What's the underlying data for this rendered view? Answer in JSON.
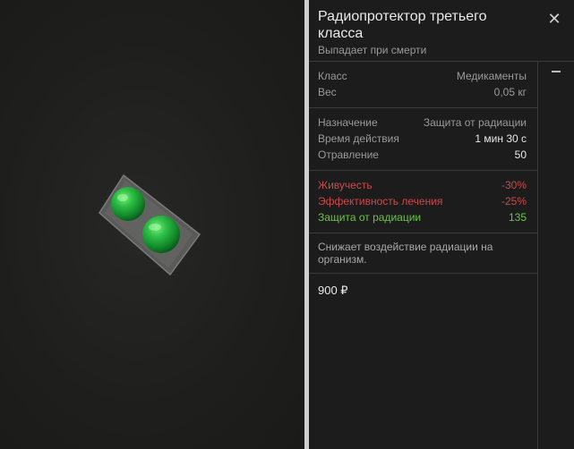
{
  "item": {
    "title": "Радиопротектор третьего класса",
    "subtitle": "Выпадает при смерти",
    "close_icon": "close-icon"
  },
  "basic": [
    {
      "label": "Класс",
      "value": "Медикаменты"
    },
    {
      "label": "Вес",
      "value": "0,05 кг"
    }
  ],
  "usage": [
    {
      "label": "Назначение",
      "value": "Защита от радиации"
    },
    {
      "label": "Время действия",
      "value": "1 мин 30 с"
    },
    {
      "label": "Отравление",
      "value": "50"
    }
  ],
  "effects": [
    {
      "label": "Живучесть",
      "value": "-30%"
    },
    {
      "label": "Эффективность лечения",
      "value": "-25%"
    },
    {
      "label": "Защита от радиации",
      "value": "135"
    }
  ],
  "description": "Снижает воздействие радиации на организм.",
  "price": "900 ₽",
  "colors": {
    "negative": "#c94a4a",
    "positive": "#6cc24a",
    "pill": "#1f9a3a"
  }
}
